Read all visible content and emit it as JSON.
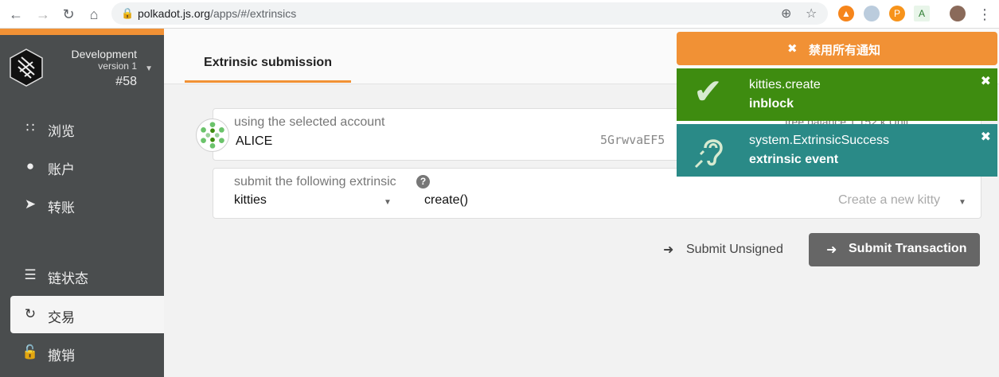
{
  "browser": {
    "url_host": "polkadot.js.org",
    "url_path": "/apps/#/extrinsics"
  },
  "chain": {
    "name": "Development",
    "version": "version 1",
    "block": "#58"
  },
  "sidebar": {
    "items": [
      {
        "label": "浏览",
        "icon": "apps-icon"
      },
      {
        "label": "账户",
        "icon": "users-icon"
      },
      {
        "label": "转账",
        "icon": "send-icon"
      },
      {
        "label": "链状态",
        "icon": "database-icon"
      },
      {
        "label": "交易",
        "icon": "sync-icon",
        "active": true
      },
      {
        "label": "撤销",
        "icon": "unlock-icon"
      }
    ]
  },
  "tabs": [
    {
      "label": "Extrinsic submission"
    }
  ],
  "account": {
    "label": "using the selected account",
    "name": "ALICE",
    "address_partial": "5GrwvaEF5",
    "address_tail": "...",
    "balance_partial": "free balance 1.152 k Unit"
  },
  "extrinsic": {
    "label": "submit the following extrinsic",
    "module": "kitties",
    "method": "create()",
    "description": "Create a new kitty"
  },
  "actions": {
    "unsigned_label": "Submit Unsigned",
    "submit_label": "Submit Transaction"
  },
  "notifications": {
    "disable_all_label": "禁用所有通知",
    "items": [
      {
        "title": "kitties.create",
        "status": "inblock",
        "color": "#3e8c10"
      },
      {
        "title": "system.ExtrinsicSuccess",
        "status": "extrinsic event",
        "color": "#2a8a87"
      }
    ]
  },
  "colors": {
    "accent": "#f19135",
    "sidebar": "#4a4d4e",
    "success": "#3e8c10",
    "event": "#2a8a87"
  }
}
